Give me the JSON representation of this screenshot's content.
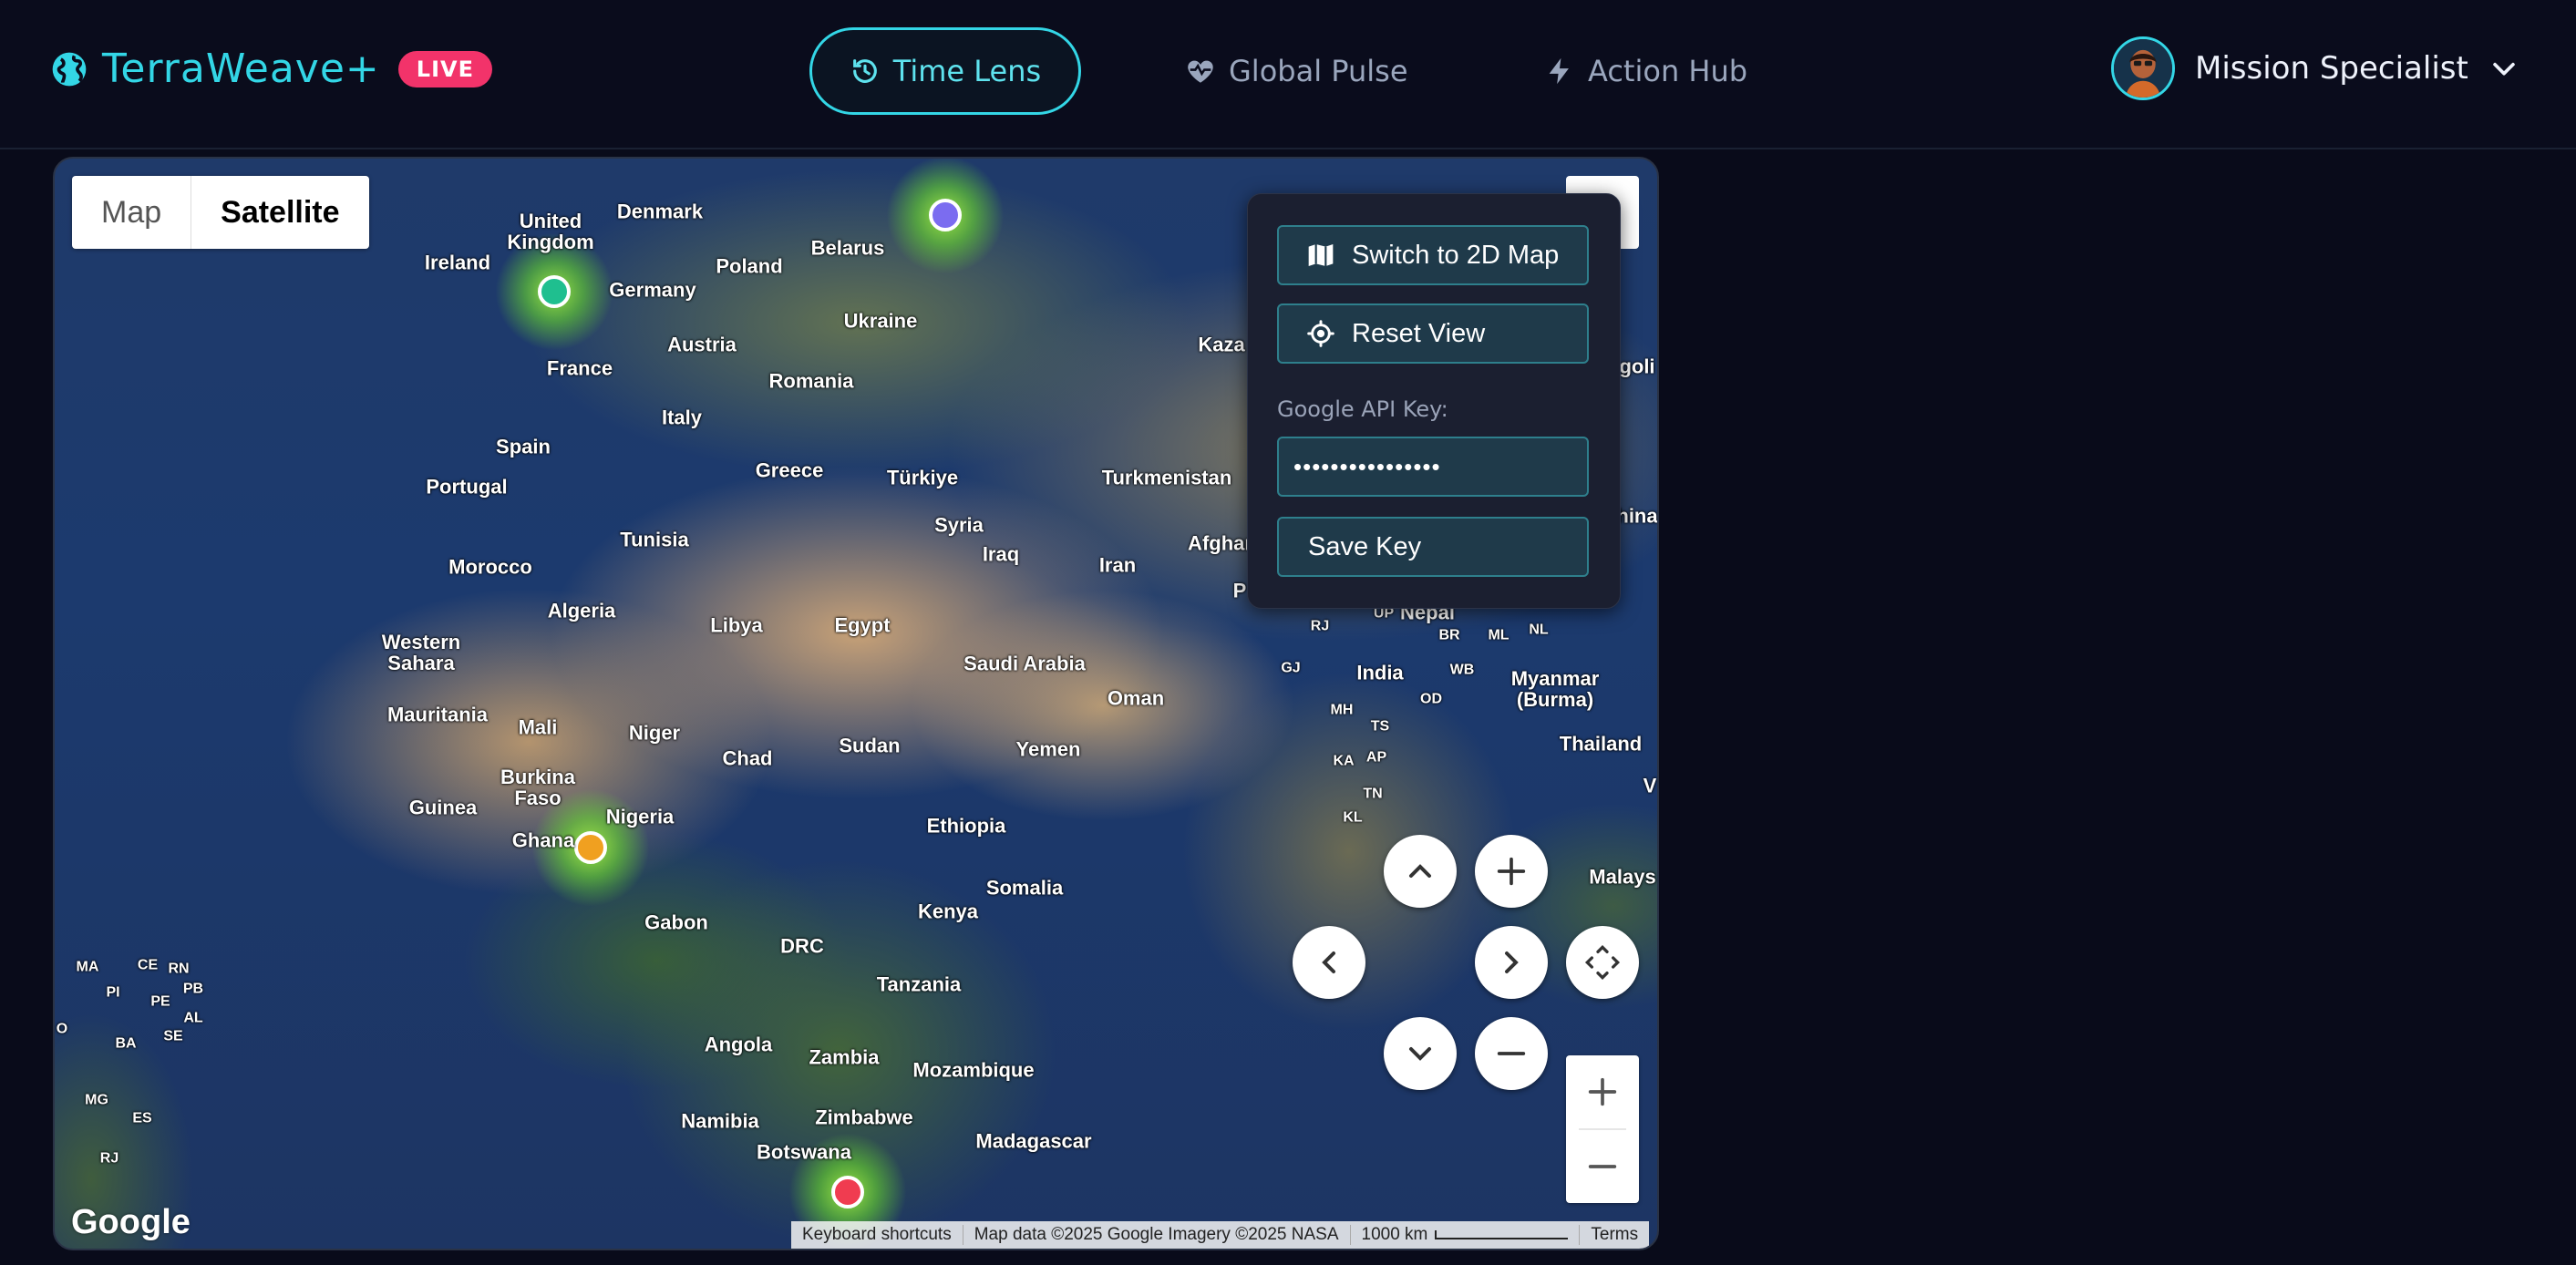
{
  "header": {
    "brand_name": "TerraWeave+",
    "live_badge": "LIVE",
    "nav": [
      {
        "label": "Time Lens",
        "icon": "history-icon",
        "active": true
      },
      {
        "label": "Global Pulse",
        "icon": "heart-pulse-icon",
        "active": false
      },
      {
        "label": "Action Hub",
        "icon": "bolt-icon",
        "active": false
      }
    ],
    "user_name": "Mission Specialist",
    "accent_color": "#33d6e6",
    "live_color": "#f2336a"
  },
  "map": {
    "map_type_options": [
      "Map",
      "Satellite"
    ],
    "selected_map_type": "Satellite",
    "labels": {
      "united_kingdom": "United\nKingdom",
      "denmark": "Denmark",
      "belarus": "Belarus",
      "ireland": "Ireland",
      "poland": "Poland",
      "germany": "Germany",
      "ukraine": "Ukraine",
      "austria": "Austria",
      "france": "France",
      "romania": "Romania",
      "italy": "Italy",
      "spain": "Spain",
      "portugal": "Portugal",
      "greece": "Greece",
      "turkiye": "Türkiye",
      "turkmenistan": "Turkmenistan",
      "kazakhstan": "Kaza",
      "syria": "Syria",
      "iraq": "Iraq",
      "iran": "Iran",
      "afghanistan": "Afghani",
      "tunisia": "Tunisia",
      "morocco": "Morocco",
      "algeria": "Algeria",
      "libya": "Libya",
      "egypt": "Egypt",
      "western_sahara": "Western\nSahara",
      "saudi_arabia": "Saudi Arabia",
      "oman": "Oman",
      "mauritania": "Mauritania",
      "mali": "Mali",
      "niger": "Niger",
      "chad": "Chad",
      "sudan": "Sudan",
      "yemen": "Yemen",
      "burkina_faso": "Burkina\nFaso",
      "guinea": "Guinea",
      "nigeria": "Nigeria",
      "ghana": "Ghana",
      "ethiopia": "Ethiopia",
      "somalia": "Somalia",
      "kenya": "Kenya",
      "gabon": "Gabon",
      "drc": "DRC",
      "tanzania": "Tanzania",
      "angola": "Angola",
      "zambia": "Zambia",
      "mozambique": "Mozambique",
      "zimbabwe": "Zimbabwe",
      "namibia": "Namibia",
      "botswana": "Botswana",
      "madagascar": "Madagascar",
      "india": "India",
      "nepal": "Nepal",
      "myanmar": "Myanmar\n(Burma)",
      "thailand": "Thailand",
      "malaysia": "Malays",
      "china": "hina",
      "mongolia": "goli",
      "vietnam": "V",
      "pakistan": "P",
      "up": "UP",
      "rj": "RJ",
      "br": "BR",
      "ml": "ML",
      "nl": "NL",
      "gj": "GJ",
      "wb": "WB",
      "mh": "MH",
      "od": "OD",
      "ts": "TS",
      "ka": "KA",
      "ap": "AP",
      "tn": "TN",
      "kl": "KL",
      "ma": "MA",
      "ce": "CE",
      "rn": "RN",
      "pb": "PB",
      "pi": "PI",
      "pe": "PE",
      "al": "AL",
      "ba": "BA",
      "se": "SE",
      "mg": "MG",
      "es": "ES",
      "rj_br": "RJ",
      "o": "O"
    },
    "markers": [
      {
        "name": "marker-uk",
        "color": "#1fbf8f"
      },
      {
        "name": "marker-belarus",
        "color": "#7b6cf0"
      },
      {
        "name": "marker-nigeria",
        "color": "#f0a020"
      },
      {
        "name": "marker-botswana",
        "color": "#f03c50"
      }
    ],
    "google_logo": "Google",
    "attribution": {
      "keyboard": "Keyboard shortcuts",
      "data": "Map data ©2025 Google Imagery ©2025 NASA",
      "scale": "1000 km",
      "terms": "Terms"
    }
  },
  "panel": {
    "switch_label": "Switch to 2D Map",
    "reset_label": "Reset View",
    "api_key_label": "Google API Key:",
    "api_key_value": "••••••••••••••••",
    "save_label": "Save Key"
  }
}
